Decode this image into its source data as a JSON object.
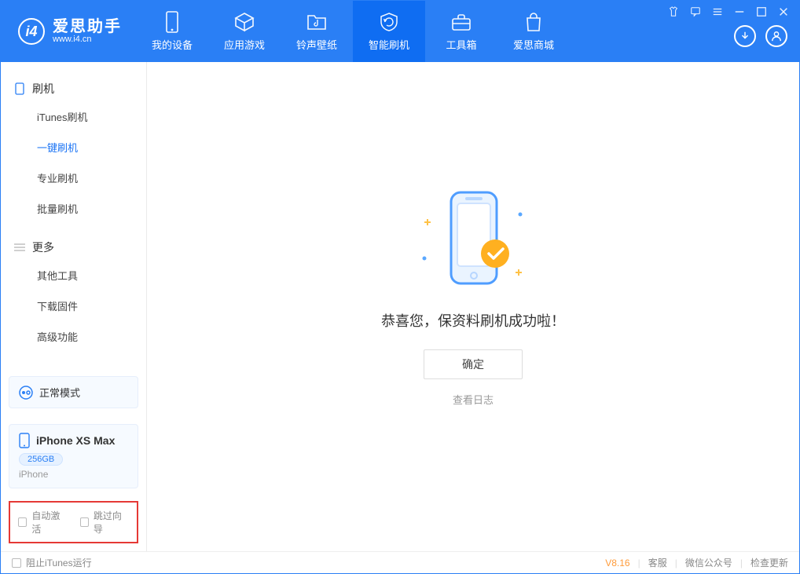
{
  "app": {
    "name_cn": "爱思助手",
    "url": "www.i4.cn"
  },
  "nav": [
    {
      "key": "device",
      "label": "我的设备",
      "active": false
    },
    {
      "key": "apps",
      "label": "应用游戏",
      "active": false
    },
    {
      "key": "ring",
      "label": "铃声壁纸",
      "active": false
    },
    {
      "key": "flash",
      "label": "智能刷机",
      "active": true
    },
    {
      "key": "toolbox",
      "label": "工具箱",
      "active": false
    },
    {
      "key": "store",
      "label": "爱思商城",
      "active": false
    }
  ],
  "sidebar": {
    "group1_title": "刷机",
    "items1": [
      {
        "key": "itunes",
        "label": "iTunes刷机",
        "active": false
      },
      {
        "key": "onekey",
        "label": "一键刷机",
        "active": true
      },
      {
        "key": "pro",
        "label": "专业刷机",
        "active": false
      },
      {
        "key": "batch",
        "label": "批量刷机",
        "active": false
      }
    ],
    "group2_title": "更多",
    "items2": [
      {
        "key": "other",
        "label": "其他工具"
      },
      {
        "key": "fw",
        "label": "下载固件"
      },
      {
        "key": "adv",
        "label": "高级功能"
      }
    ]
  },
  "mode_card": {
    "label": "正常模式"
  },
  "device": {
    "name": "iPhone XS Max",
    "storage": "256GB",
    "type": "iPhone"
  },
  "highlight": {
    "auto_activate": "自动激活",
    "skip_guide": "跳过向导"
  },
  "main": {
    "message": "恭喜您，保资料刷机成功啦！",
    "ok": "确定",
    "view_log": "查看日志"
  },
  "footer": {
    "block_itunes": "阻止iTunes运行",
    "version": "V8.16",
    "support": "客服",
    "wechat": "微信公众号",
    "update": "检查更新"
  }
}
